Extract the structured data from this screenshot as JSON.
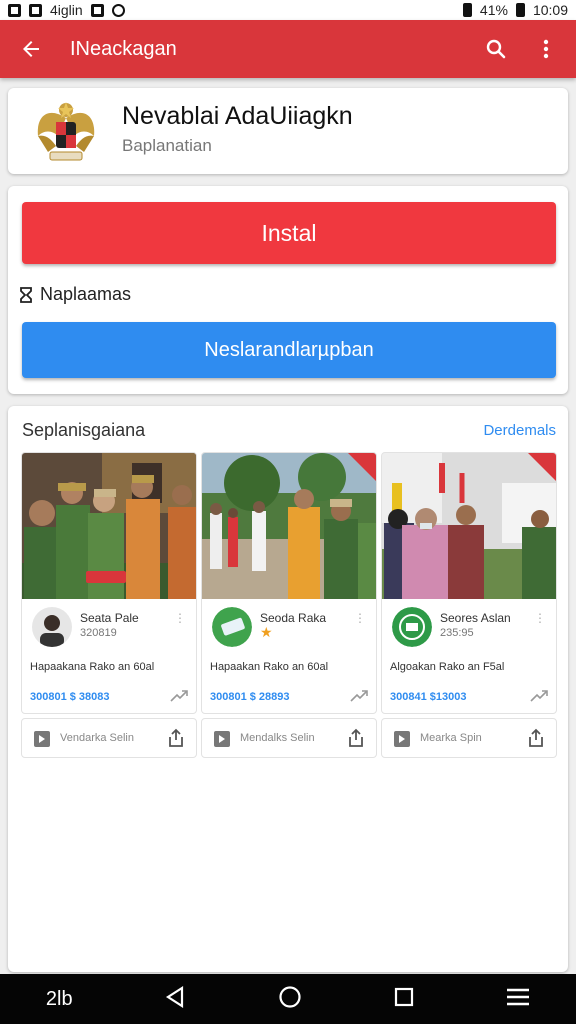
{
  "status_bar": {
    "left_text": "4iglin",
    "battery": "41%",
    "time": "10:09"
  },
  "appbar": {
    "title": "INeackagan",
    "back_icon": "arrow-left-icon",
    "search_icon": "search-icon",
    "menu_icon": "more-vert-icon"
  },
  "app": {
    "name": "Nevablai AdaUiiagkn",
    "subtitle": "Baplanatian"
  },
  "actions": {
    "install_label": "Instal",
    "ads_label": "Naplaamas",
    "secondary_label": "Neslarandlarµpban"
  },
  "section": {
    "title": "Seplanisgaiana",
    "link": "Derdemals",
    "tiles": [
      {
        "name": "Seata Pale",
        "sub": "320819",
        "desc": "Hapaakana Rako an 60al",
        "price": "300801 $ 38083",
        "video_label": "Vendarka Selin"
      },
      {
        "name": "Seoda Raka",
        "sub": "★",
        "desc": "Hapaakan Rako an 60al",
        "price": "300801 $ 28893",
        "video_label": "Mendalks Selin"
      },
      {
        "name": "Seores Aslan",
        "sub": "235:95",
        "desc": "Algoakan Rako an F5al",
        "price": "300841 $13003",
        "video_label": "Mearka Spin"
      }
    ]
  },
  "navbar": {
    "label": "2lb"
  },
  "colors": {
    "appbar": "#d9363b",
    "install": "#f0383f",
    "secondary": "#2f8cf0",
    "link": "#2f8cf0"
  }
}
